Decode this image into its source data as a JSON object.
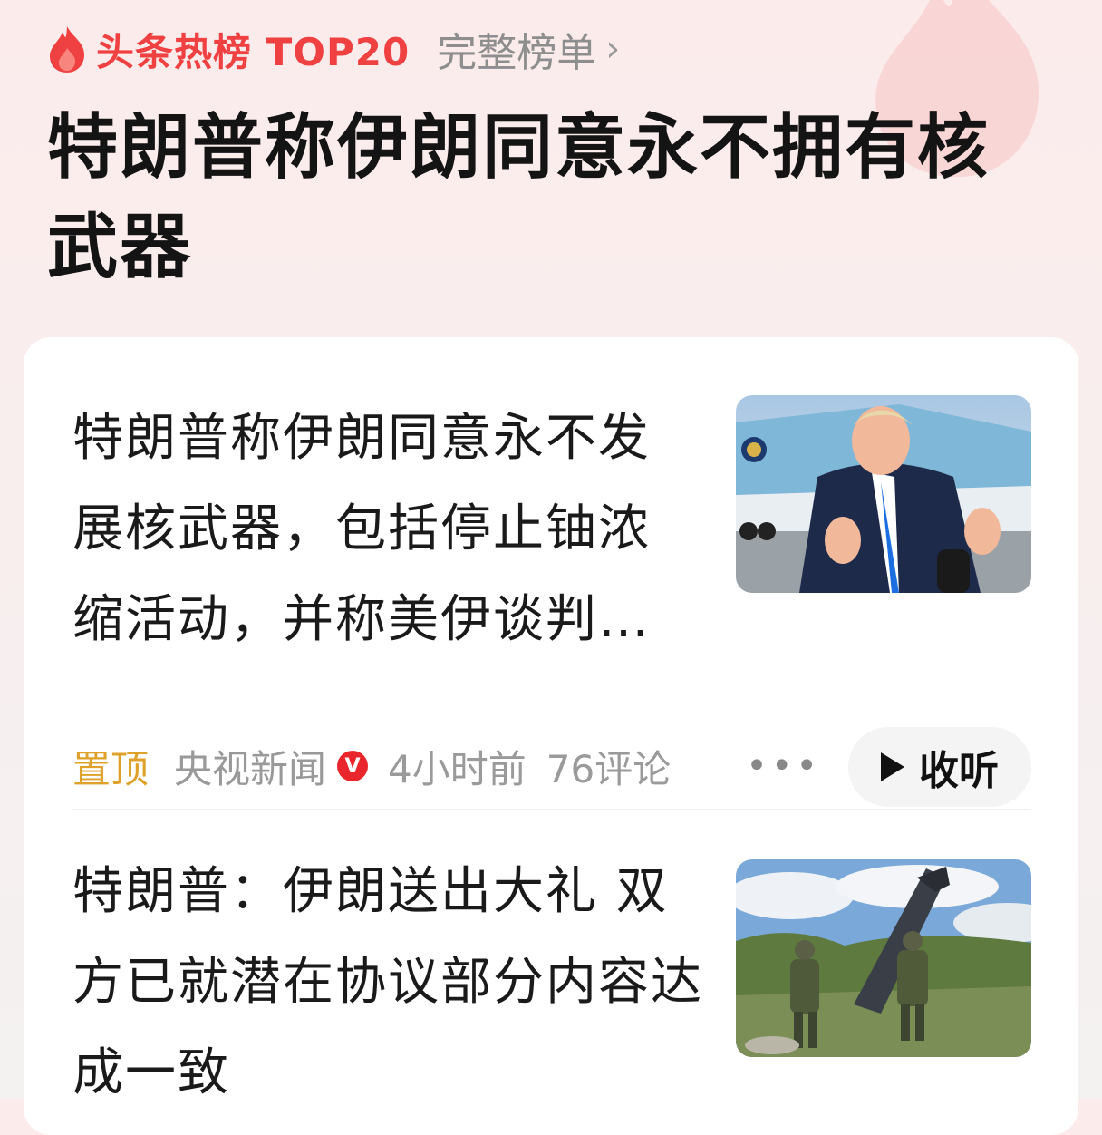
{
  "header": {
    "brand": "头条热榜 TOP20",
    "full_list": "完整榜单",
    "chevron": "›"
  },
  "topic": {
    "title": "特朗普称伊朗同意永不拥有核武器"
  },
  "items": [
    {
      "title": "特朗普称伊朗同意永不发展核武器，包括停止铀浓缩活动，并称美伊谈判…",
      "pin_label": "置顶",
      "source": "央视新闻",
      "verified_badge": "V",
      "time": "4小时前",
      "comments": "76评论",
      "more": "•••",
      "listen_label": "收听"
    },
    {
      "title": "特朗普：伊朗送出大礼 双方已就潜在协议部分内容达成一致"
    }
  ],
  "colors": {
    "brand_red": "#f04142",
    "pin_gold": "#e0a12a",
    "verified_red": "#e8262b"
  }
}
